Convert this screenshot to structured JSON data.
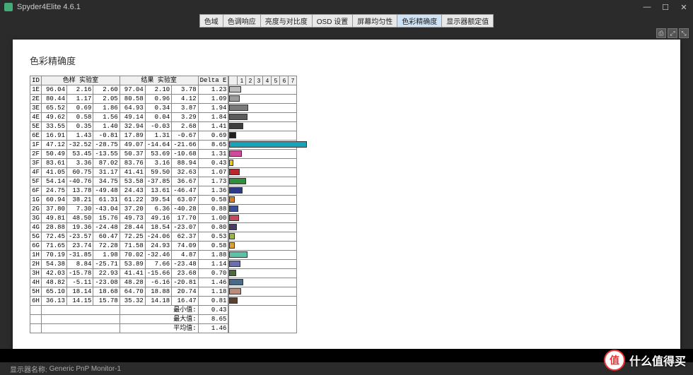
{
  "window": {
    "title": "Spyder4Elite 4.6.1",
    "min": "—",
    "max": "☐",
    "close": "✕"
  },
  "tabs": [
    "色域",
    "色调响应",
    "亮度与对比度",
    "OSD 设置",
    "屏幕均匀性",
    "色彩精确度",
    "显示器额定值"
  ],
  "active_tab": 5,
  "toolbar": [
    "⎙",
    "⤢",
    "⤡"
  ],
  "heading": "色彩精确度",
  "columns": {
    "id": "ID",
    "sample": "色样 实验室",
    "result": "结果 实验室",
    "delta": "Delta E"
  },
  "scale_labels": [
    "1",
    "2",
    "3",
    "4",
    "5",
    "6",
    "7"
  ],
  "rows": [
    {
      "id": "1E",
      "s": [
        96.04,
        2.16,
        2.6
      ],
      "r": [
        97.04,
        2.1,
        3.78
      ],
      "de": 1.23,
      "c": "#bdbdbd"
    },
    {
      "id": "2E",
      "s": [
        80.44,
        1.17,
        2.05
      ],
      "r": [
        80.58,
        0.96,
        4.12
      ],
      "de": 1.09,
      "c": "#9c9c9c"
    },
    {
      "id": "3E",
      "s": [
        65.52,
        0.69,
        1.86
      ],
      "r": [
        64.93,
        0.34,
        3.87
      ],
      "de": 1.94,
      "c": "#7a7a7a"
    },
    {
      "id": "4E",
      "s": [
        49.62,
        0.58,
        1.56
      ],
      "r": [
        49.14,
        0.04,
        3.29
      ],
      "de": 1.84,
      "c": "#5b5b5b"
    },
    {
      "id": "5E",
      "s": [
        33.55,
        0.35,
        1.4
      ],
      "r": [
        32.94,
        -0.03,
        2.68
      ],
      "de": 1.41,
      "c": "#3d3d3d"
    },
    {
      "id": "6E",
      "s": [
        16.91,
        1.43,
        -0.81
      ],
      "r": [
        17.89,
        1.31,
        -0.67
      ],
      "de": 0.69,
      "c": "#1f1f1f"
    },
    {
      "id": "1F",
      "s": [
        47.12,
        -32.52,
        -28.75
      ],
      "r": [
        49.07,
        -14.64,
        -21.66
      ],
      "de": 8.65,
      "c": "#18a3b8"
    },
    {
      "id": "2F",
      "s": [
        50.49,
        53.45,
        -13.55
      ],
      "r": [
        50.37,
        53.69,
        -10.68
      ],
      "de": 1.31,
      "c": "#d04a9b"
    },
    {
      "id": "3F",
      "s": [
        83.61,
        3.36,
        87.02
      ],
      "r": [
        83.76,
        3.16,
        88.94
      ],
      "de": 0.43,
      "c": "#e6c81e"
    },
    {
      "id": "4F",
      "s": [
        41.05,
        60.75,
        31.17
      ],
      "r": [
        41.41,
        59.5,
        32.63
      ],
      "de": 1.07,
      "c": "#b8272f"
    },
    {
      "id": "5F",
      "s": [
        54.14,
        -40.76,
        34.75
      ],
      "r": [
        53.58,
        -37.85,
        36.67
      ],
      "de": 1.73,
      "c": "#2f8f3a"
    },
    {
      "id": "6F",
      "s": [
        24.75,
        13.78,
        -49.48
      ],
      "r": [
        24.43,
        13.61,
        -46.47
      ],
      "de": 1.36,
      "c": "#2c3a8a"
    },
    {
      "id": "1G",
      "s": [
        60.94,
        38.21,
        61.31
      ],
      "r": [
        61.22,
        39.54,
        63.07
      ],
      "de": 0.58,
      "c": "#d87a1e"
    },
    {
      "id": "2G",
      "s": [
        37.8,
        7.3,
        -43.04
      ],
      "r": [
        37.2,
        6.36,
        -40.28
      ],
      "de": 0.88,
      "c": "#3a4f9a"
    },
    {
      "id": "3G",
      "s": [
        49.81,
        48.5,
        15.76
      ],
      "r": [
        49.73,
        49.16,
        17.7
      ],
      "de": 1.0,
      "c": "#c24a5a"
    },
    {
      "id": "4G",
      "s": [
        28.88,
        19.36,
        -24.48
      ],
      "r": [
        28.44,
        18.54,
        -23.07
      ],
      "de": 0.8,
      "c": "#4a3a6a"
    },
    {
      "id": "5G",
      "s": [
        72.45,
        -23.57,
        60.47
      ],
      "r": [
        72.25,
        -24.06,
        62.37
      ],
      "de": 0.53,
      "c": "#9ab83a"
    },
    {
      "id": "6G",
      "s": [
        71.65,
        23.74,
        72.28
      ],
      "r": [
        71.58,
        24.93,
        74.09
      ],
      "de": 0.58,
      "c": "#e0a030"
    },
    {
      "id": "1H",
      "s": [
        70.19,
        -31.85,
        1.98
      ],
      "r": [
        70.02,
        -32.46,
        4.87
      ],
      "de": 1.88,
      "c": "#5ac3a8"
    },
    {
      "id": "2H",
      "s": [
        54.38,
        8.84,
        -25.71
      ],
      "r": [
        53.89,
        7.66,
        -23.48
      ],
      "de": 1.14,
      "c": "#6a6fa8"
    },
    {
      "id": "3H",
      "s": [
        42.03,
        -15.78,
        22.93
      ],
      "r": [
        41.41,
        -15.66,
        23.68
      ],
      "de": 0.7,
      "c": "#4a6a3a"
    },
    {
      "id": "4H",
      "s": [
        48.82,
        -5.11,
        -23.08
      ],
      "r": [
        48.28,
        -6.16,
        -20.81
      ],
      "de": 1.46,
      "c": "#4a6a8a"
    },
    {
      "id": "5H",
      "s": [
        65.1,
        18.14,
        18.68
      ],
      "r": [
        64.7,
        18.88,
        20.74
      ],
      "de": 1.18,
      "c": "#c08a78"
    },
    {
      "id": "6H",
      "s": [
        36.13,
        14.15,
        15.78
      ],
      "r": [
        35.32,
        14.18,
        16.47
      ],
      "de": 0.81,
      "c": "#5a4232"
    }
  ],
  "summary": {
    "min_label": "最小值:",
    "min": 0.43,
    "max_label": "最大值:",
    "max": 8.65,
    "avg_label": "平均值:",
    "avg": 1.46
  },
  "status": {
    "label": "显示器名称:",
    "value": "Generic PnP Monitor-1"
  },
  "watermark": {
    "badge": "值",
    "text": "什么值得买"
  },
  "chart_data": {
    "type": "bar",
    "title": "色彩精确度",
    "xlabel": "Delta E",
    "xlim": [
      0,
      7
    ],
    "categories": [
      "1E",
      "2E",
      "3E",
      "4E",
      "5E",
      "6E",
      "1F",
      "2F",
      "3F",
      "4F",
      "5F",
      "6F",
      "1G",
      "2G",
      "3G",
      "4G",
      "5G",
      "6G",
      "1H",
      "2H",
      "3H",
      "4H",
      "5H",
      "6H"
    ],
    "values": [
      1.23,
      1.09,
      1.94,
      1.84,
      1.41,
      0.69,
      8.65,
      1.31,
      0.43,
      1.07,
      1.73,
      1.36,
      0.58,
      0.88,
      1.0,
      0.8,
      0.53,
      0.58,
      1.88,
      1.14,
      0.7,
      1.46,
      1.18,
      0.81
    ]
  }
}
